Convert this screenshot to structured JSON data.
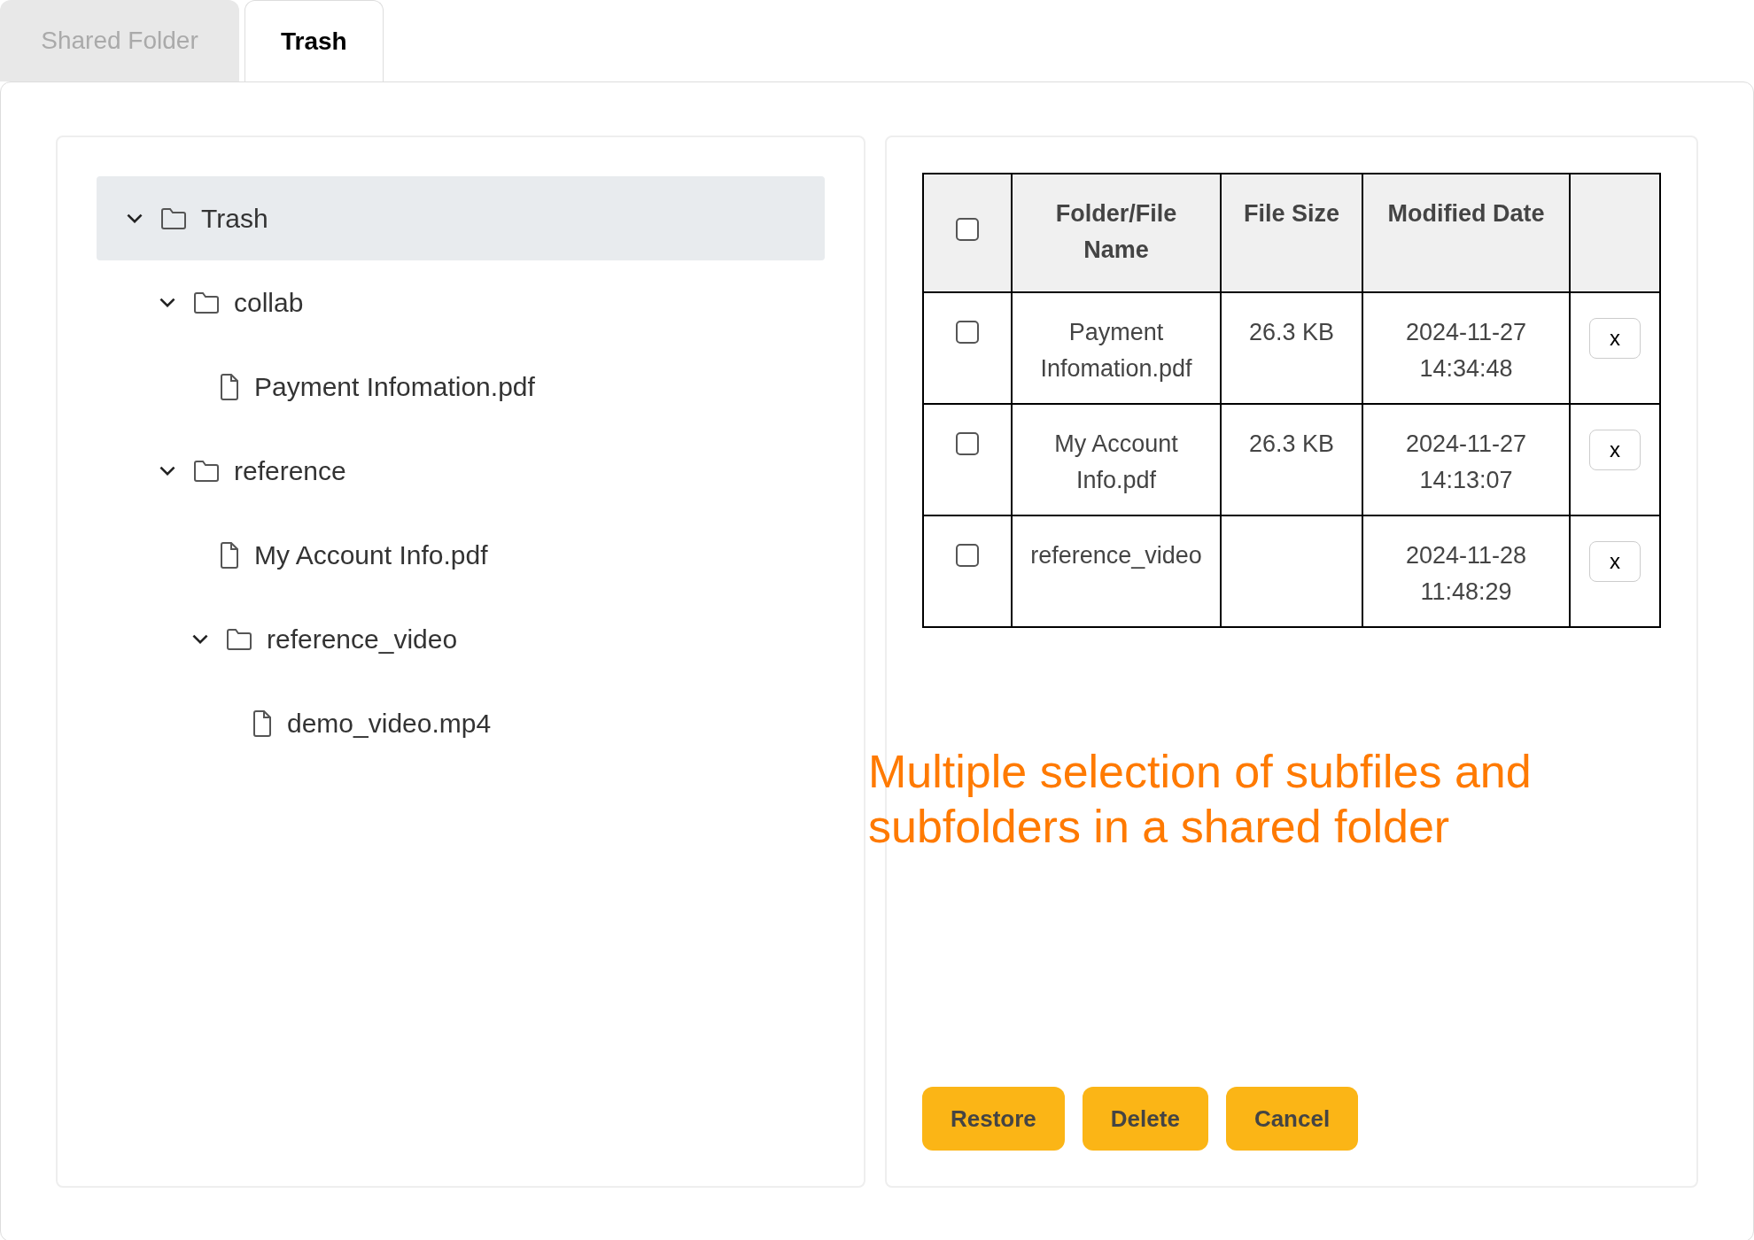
{
  "tabs": [
    {
      "label": "Shared Folder",
      "selected": false
    },
    {
      "label": "Trash",
      "selected": true
    }
  ],
  "tree": [
    {
      "label": "Trash",
      "kind": "folder",
      "expanded": true,
      "selected": true,
      "children": [
        {
          "label": "collab",
          "kind": "folder",
          "expanded": true,
          "selected": false,
          "children": [
            {
              "label": "Payment Infomation.pdf",
              "kind": "file",
              "selected": false
            }
          ]
        },
        {
          "label": "reference",
          "kind": "folder",
          "expanded": true,
          "selected": false,
          "children": [
            {
              "label": "My Account Info.pdf",
              "kind": "file",
              "selected": false
            },
            {
              "label": "reference_video",
              "kind": "folder",
              "expanded": true,
              "selected": false,
              "children": [
                {
                  "label": "demo_video.mp4",
                  "kind": "file",
                  "selected": false
                }
              ]
            }
          ]
        }
      ]
    }
  ],
  "table": {
    "select_all_checked": false,
    "columns": [
      "Folder/File Name",
      "File Size",
      "Modified Date"
    ],
    "rows": [
      {
        "checked": false,
        "name": "Payment Infomation.pdf",
        "size": "26.3 KB",
        "date": "2024-11-27 14:34:48",
        "action": "x"
      },
      {
        "checked": false,
        "name": "My Account Info.pdf",
        "size": "26.3 KB",
        "date": "2024-11-27 14:13:07",
        "action": "x"
      },
      {
        "checked": false,
        "name": "reference_video",
        "date": "2024-11-28 11:48:29",
        "action": "x"
      }
    ]
  },
  "buttons": [
    "Restore",
    "Delete",
    "Cancel"
  ],
  "annotation": "Multiple selection of subfiles and subfolders in a shared folder"
}
